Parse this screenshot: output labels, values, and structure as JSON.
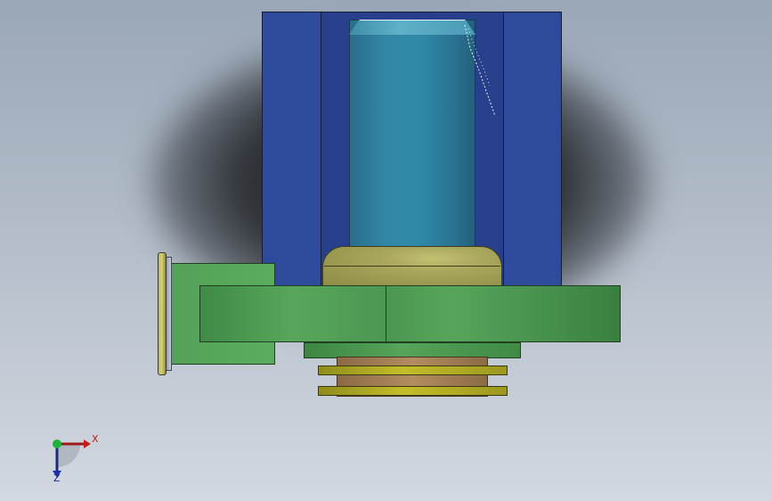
{
  "viewport": {
    "background_top": "#9aa7b7",
    "background_bottom": "#d3d8e0"
  },
  "model": {
    "colors": {
      "outer_sleeve": "#2d4a9c",
      "piston": "#2f8aa9",
      "dome": "#a8a55c",
      "plate": "#58a65d",
      "shaft": "#b58c60",
      "washer": "#c4bd2a"
    }
  },
  "triad": {
    "x_label": "X",
    "z_label": "Z",
    "x_color": "#c21e1e",
    "y_color": "#1fb33a",
    "z_color": "#1d2fa8",
    "icon": "coordinate-triad-icon"
  }
}
